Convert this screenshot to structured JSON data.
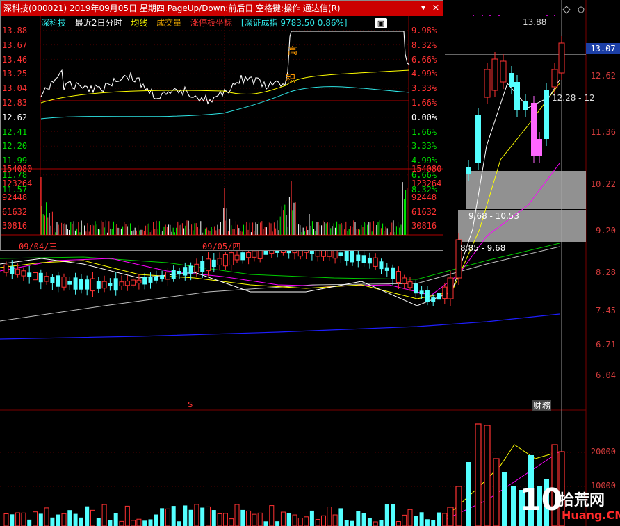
{
  "main_chart": {
    "price_scale": [
      "12.62",
      "11.36",
      "10.22",
      "9.20",
      "8.28",
      "7.45",
      "6.71",
      "6.04"
    ],
    "current_price_badge": "13.07",
    "high_label": "13.88",
    "annotation_upper": "12.28 - 12",
    "gap_label_1": "9.68 - 10.53",
    "gap_label_2": "8.85 - 9.68",
    "finance_marker": "财",
    "dividend_marker": "$",
    "volume_scale": [
      "20000",
      "10000"
    ],
    "watermark": {
      "number": "10",
      "cn": "拾荒网",
      "url": "Huang.CN"
    },
    "colors": {
      "up": "#ff3232",
      "down": "#54ffff",
      "ma5": "#ffffff",
      "ma10": "#ffff00",
      "ma20": "#ff00ff",
      "ma60": "#00ff00",
      "ma120": "#c0c0c0",
      "ma250": "#0000ff",
      "gap_box": "#aaaaaa"
    }
  },
  "popup": {
    "title": "深科技(000021) 2019年09月05日 星期四 PageUp/Down:前后日 空格键:操作 通达信(R)",
    "dropdown_icon": "▾",
    "close_icon": "×",
    "legend": {
      "name": "深科技",
      "range": "最近2日分时",
      "avg_line": "均线",
      "volume": "成交量",
      "limit_axis": "涨停板坐标",
      "index": "[深证成指 9783.50 0.86%]"
    },
    "dropbox_icon": "▣",
    "price_axis": [
      "13.88",
      "13.67",
      "13.46",
      "13.25",
      "13.04",
      "12.83",
      "12.62",
      "12.41",
      "12.20",
      "11.99",
      "11.78",
      "11.57"
    ],
    "pct_axis": [
      "9.98%",
      "8.32%",
      "6.66%",
      "4.99%",
      "3.33%",
      "1.66%",
      "0.00%",
      "1.66%",
      "3.33%",
      "4.99%",
      "6.66%",
      "8.32%"
    ],
    "volume_axis": [
      "154080",
      "123264",
      "92448",
      "61632",
      "30816"
    ],
    "dates": [
      "09/04/三",
      "09/05/四"
    ],
    "tag_high": "高",
    "tag_accum": "积"
  }
}
